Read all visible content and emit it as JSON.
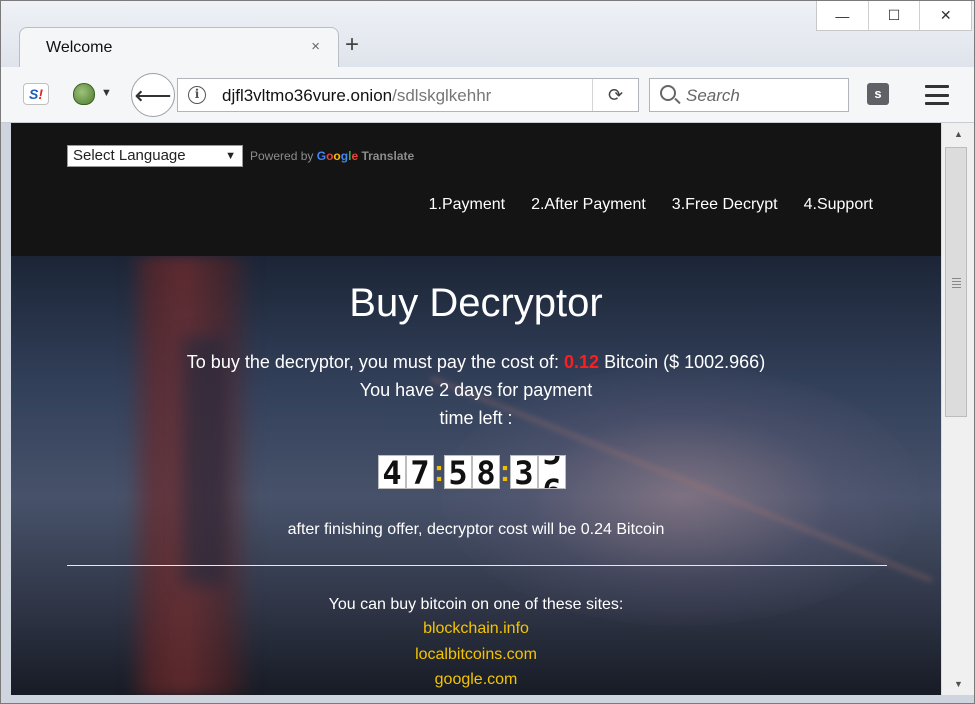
{
  "window": {
    "controls": {
      "minimize": "—",
      "maximize": "☐",
      "close": "✕"
    }
  },
  "tab": {
    "title": "Welcome",
    "close": "×",
    "new_tab": "+"
  },
  "toolbar": {
    "ext_label_main": "S",
    "ext_label_bang": "!",
    "onion_caret": "▼",
    "back": "⟵",
    "url_host": "djfl3vltmo36vure.onion",
    "url_path": "/sdlskglkehhr",
    "reload": "⟳",
    "search_placeholder": "Search",
    "ext_box": "s",
    "info": "i"
  },
  "header": {
    "language_select": "Select Language",
    "powered_by": "Powered by",
    "google": [
      "G",
      "o",
      "o",
      "g",
      "l",
      "e"
    ],
    "translate": "Translate",
    "nav": [
      "1.Payment",
      "2.After Payment",
      "3.Free Decrypt",
      "4.Support"
    ]
  },
  "main": {
    "title": "Buy Decryptor",
    "cost_prefix": "To buy the decryptor, you must pay the cost of:",
    "cost_amount": "0.12",
    "cost_suffix": "Bitcoin ($ 1002.966)",
    "days_line": "You have 2 days for payment",
    "time_left": "time left :",
    "timer": {
      "h": [
        "4",
        "7"
      ],
      "m": [
        "5",
        "8"
      ],
      "s1": "3",
      "s2_top": "5",
      "s2_bottom": "6"
    },
    "after_offer": "after finishing offer, decryptor cost will be 0.24 Bitcoin",
    "buy_intro": "You can buy bitcoin on one of these sites:",
    "sites": [
      "blockchain.info",
      "localbitcoins.com",
      "google.com"
    ]
  },
  "colors": {
    "accent_price": "#ff1e1e",
    "link_yellow": "#f5c400",
    "header_bg": "#141414"
  }
}
